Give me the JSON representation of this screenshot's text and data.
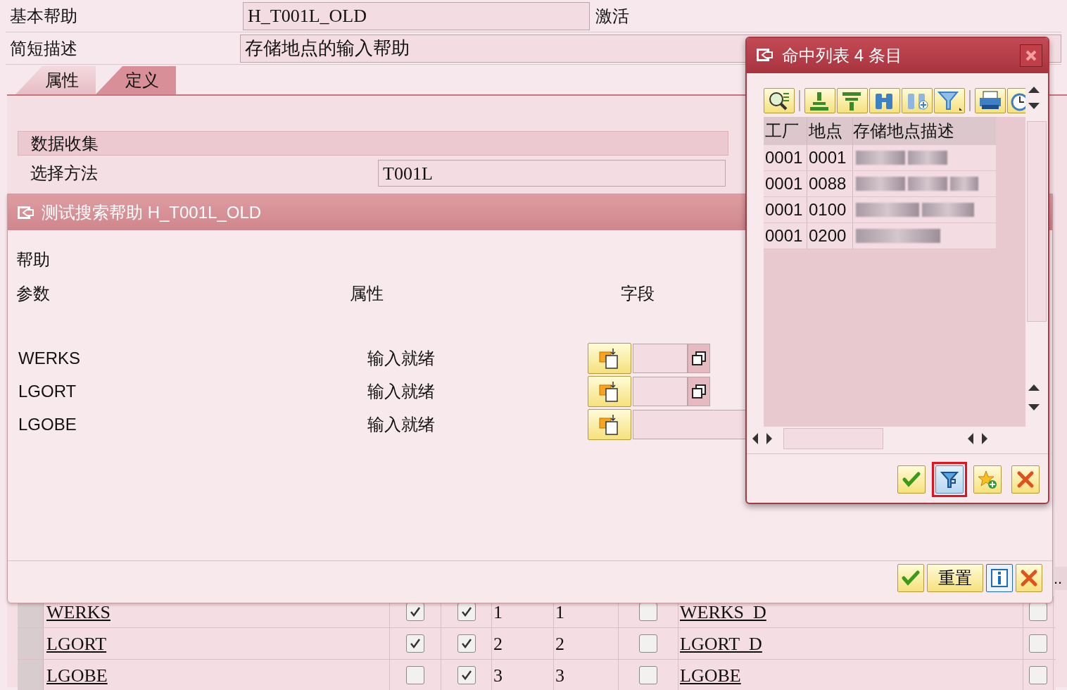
{
  "header_fields": [
    {
      "label": "基本帮助",
      "value": "H_T001L_OLD",
      "status": "激活"
    },
    {
      "label": "简短描述",
      "value": "存储地点的输入帮助"
    }
  ],
  "tabs": [
    {
      "label": "属性",
      "selected": false
    },
    {
      "label": "定义",
      "selected": true
    }
  ],
  "data_collection": {
    "title": "数据收集",
    "field_label": "选择方法",
    "field_value": "T001L"
  },
  "parameter_rows": [
    {
      "name": "WERKS",
      "check_1": true,
      "check_2": true,
      "column_4": "1",
      "column_5": "1",
      "check_3": false,
      "data_element": "WERKS_D",
      "check_4": false
    },
    {
      "name": "LGORT",
      "check_1": true,
      "check_2": true,
      "column_4": "2",
      "column_5": "2",
      "check_3": false,
      "data_element": "LGORT_D",
      "check_4": false
    },
    {
      "name": "LGOBE",
      "check_1": false,
      "check_2": true,
      "column_4": "3",
      "column_5": "3",
      "check_3": false,
      "data_element": "LGOBE",
      "check_4": false
    }
  ],
  "test_dialog": {
    "title": "测试搜索帮助 H_T001L_OLD",
    "section": "帮助",
    "columns": [
      "参数",
      "属性",
      "字段"
    ],
    "rows": [
      {
        "parameter": "WERKS",
        "attribute": "输入就绪",
        "has_copy": true
      },
      {
        "parameter": "LGORT",
        "attribute": "输入就绪",
        "has_copy": true
      },
      {
        "parameter": "LGOBE",
        "attribute": "输入就绪",
        "has_copy": false
      }
    ],
    "buttons": [
      {
        "kind": "check"
      },
      {
        "kind": "text",
        "label": "重置"
      },
      {
        "kind": "info"
      },
      {
        "kind": "cancel"
      }
    ],
    "more_button": ".."
  },
  "hit_list": {
    "title": "命中列表 4 条目",
    "columns": [
      "工厂",
      "地点",
      "存储地点描述"
    ],
    "rows": [
      {
        "plant": "0001",
        "location": "0001"
      },
      {
        "plant": "0001",
        "location": "0088"
      },
      {
        "plant": "0001",
        "location": "0100"
      },
      {
        "plant": "0001",
        "location": "0200"
      }
    ],
    "buttons": [
      {
        "kind": "check",
        "highlighted": false
      },
      {
        "kind": "filter",
        "highlighted": true
      },
      {
        "kind": "favorite",
        "highlighted": false
      },
      {
        "kind": "cancel",
        "highlighted": false
      }
    ]
  }
}
